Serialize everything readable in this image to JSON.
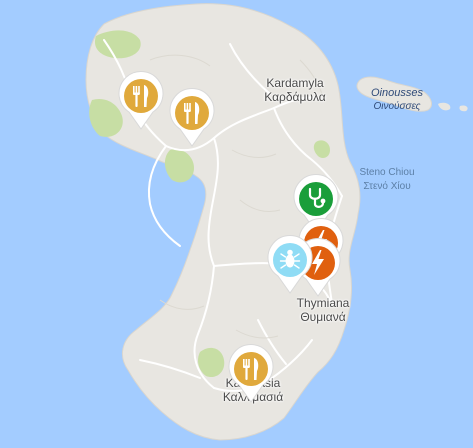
{
  "map": {
    "labels": {
      "kardamyla_latin": "Kardamyla",
      "kardamyla_greek": "Καρδάμυλα",
      "steno_latin": "Steno Chiou",
      "steno_greek": "Στενό Χίου",
      "oinousses_latin": "Oinousses",
      "oinousses_greek": "Οινούσσες",
      "thymiana_latin": "Thymiana",
      "thymiana_greek": "Θυμιανά",
      "kallimasia_latin": "Kallimasia",
      "kallimasia_greek": "Καλλιμασιά"
    },
    "markers": [
      {
        "type": "restaurant",
        "icon": "fork-knife-icon",
        "color": "#e0a93c"
      },
      {
        "type": "restaurant",
        "icon": "fork-knife-icon",
        "color": "#e0a93c"
      },
      {
        "type": "medical",
        "icon": "stethoscope-icon",
        "color": "#1a9e3a"
      },
      {
        "type": "electricity",
        "icon": "lightning-icon",
        "color": "#e0600f"
      },
      {
        "type": "electricity",
        "icon": "lightning-icon",
        "color": "#e0600f"
      },
      {
        "type": "pest-control",
        "icon": "bug-icon",
        "color": "#8fdcf5"
      },
      {
        "type": "restaurant",
        "icon": "fork-knife-icon",
        "color": "#e0a93c"
      }
    ],
    "colors": {
      "water": "#a3ccff",
      "land": "#e8e6e1",
      "park": "#c7dea4",
      "road": "#ffffff"
    }
  }
}
